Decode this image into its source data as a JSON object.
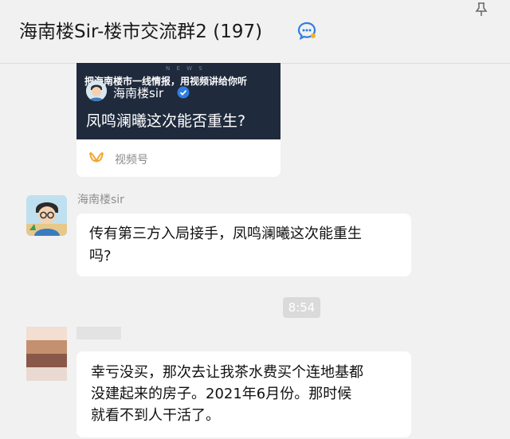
{
  "header": {
    "title": "海南楼Sir-楼市交流群2 (197)",
    "title_icon": "chat-bubble-icon",
    "pin_icon": "pin-icon"
  },
  "video_card": {
    "news_watermark": "N E W S",
    "caption": "把海南楼市一线情报，用视频讲给你听",
    "account_name": "海南楼sir",
    "title": "凤鸣澜曦这次能否重生?",
    "source_label": "视频号",
    "source_icon": "wechat-channels-icon"
  },
  "messages": [
    {
      "sender": "海南楼sir",
      "lines": [
        "传有第三方入局接手，凤鸣澜曦这次能重生",
        "吗?"
      ]
    },
    {
      "sender": "",
      "lines": [
        "幸亏没买，那次去让我茶水费买个连地基都",
        "没建起来的房子。2021年6月份。那时候",
        "就看不到人干活了。"
      ]
    }
  ],
  "timestamp": "8:54",
  "colors": {
    "background": "#f1f1f1",
    "bubble": "#ffffff",
    "video_thumb": "#1f2a3d",
    "timestamp_bg": "#dadada",
    "accent": "#2f7de1"
  }
}
